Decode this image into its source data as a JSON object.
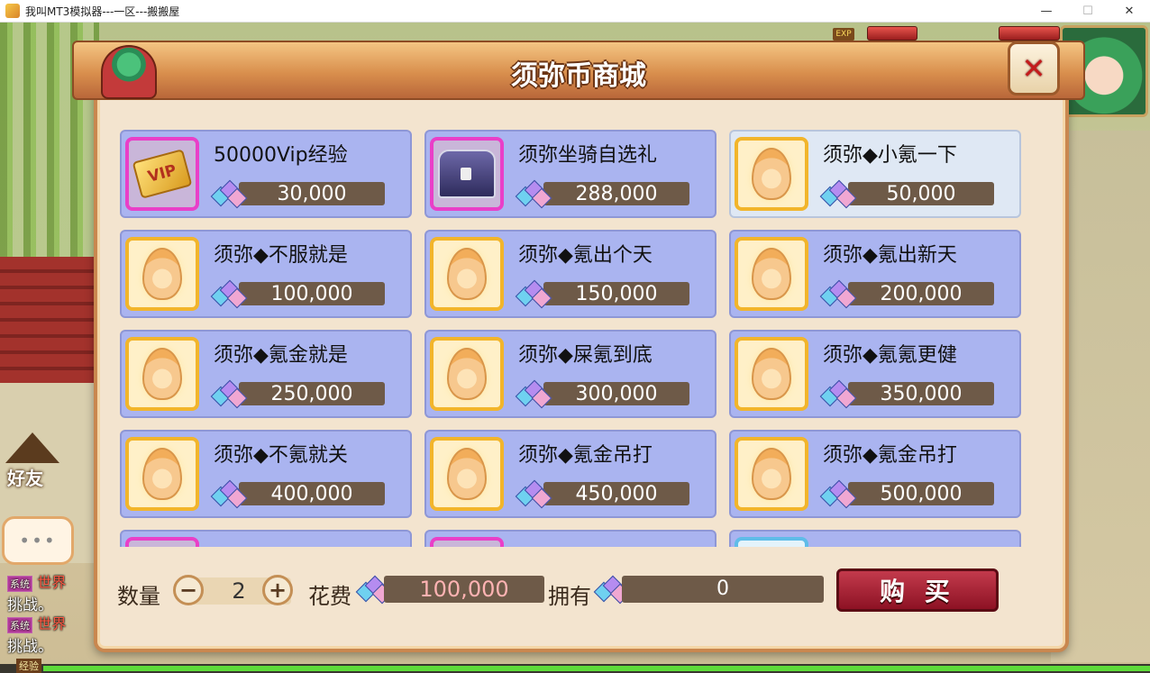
{
  "window": {
    "title": "我叫MT3模拟器---一区---搬搬屋",
    "minimize": "—",
    "maximize": "☐",
    "close": "✕"
  },
  "shop": {
    "title": "须弥币商城",
    "close_label": "✕",
    "items": [
      {
        "name": "50000Vip经验",
        "price": "30,000",
        "icon": "vip-ticket",
        "frame": "pink"
      },
      {
        "name": "须弥坐骑自选礼",
        "price": "288,000",
        "icon": "treasure-chest",
        "frame": "pink"
      },
      {
        "name": "须弥◆小氪一下",
        "price": "50,000",
        "icon": "egg",
        "frame": "gold"
      },
      {
        "name": "须弥◆不服就是",
        "price": "100,000",
        "icon": "egg",
        "frame": "gold"
      },
      {
        "name": "须弥◆氪出个天",
        "price": "150,000",
        "icon": "egg",
        "frame": "gold"
      },
      {
        "name": "须弥◆氪出新天",
        "price": "200,000",
        "icon": "egg",
        "frame": "gold"
      },
      {
        "name": "须弥◆氪金就是",
        "price": "250,000",
        "icon": "egg",
        "frame": "gold"
      },
      {
        "name": "须弥◆屎氪到底",
        "price": "300,000",
        "icon": "egg",
        "frame": "gold"
      },
      {
        "name": "须弥◆氪氪更健",
        "price": "350,000",
        "icon": "egg",
        "frame": "gold"
      },
      {
        "name": "须弥◆不氪就关",
        "price": "400,000",
        "icon": "egg",
        "frame": "gold"
      },
      {
        "name": "须弥◆氪金吊打",
        "price": "450,000",
        "icon": "egg",
        "frame": "gold"
      },
      {
        "name": "须弥◆氪金吊打",
        "price": "500,000",
        "icon": "egg",
        "frame": "gold"
      }
    ]
  },
  "purchase": {
    "quantity_label": "数量",
    "quantity_value": "2",
    "minus": "−",
    "plus": "+",
    "cost_label": "花费",
    "cost_value": "100,000",
    "own_label": "拥有",
    "own_value": "0",
    "buy_label": "购 买"
  },
  "side": {
    "friend_label": "好友",
    "chat_lines": [
      {
        "badge": "系统",
        "text": "世界",
        "line2": "挑战。"
      },
      {
        "badge": "系统",
        "text": "世界",
        "line2": "挑战。"
      }
    ],
    "exp_label": "经验",
    "exp_badge": "EXP"
  },
  "colors": {
    "card_bg": "#aab4f0",
    "card_selected": "#dfe8f4",
    "price_bar": "#6e5a48",
    "buy_button": "#9a1a2c",
    "panel_bg": "#f3e4cf"
  }
}
